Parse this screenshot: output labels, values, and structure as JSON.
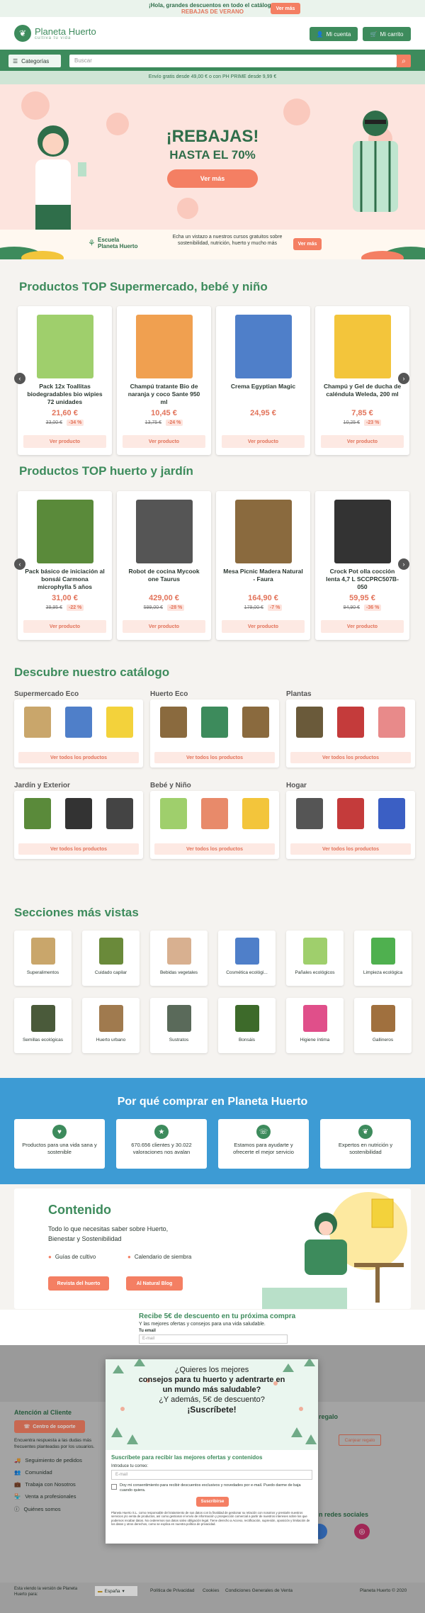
{
  "topbar": {
    "promo": "¡Hola, grandes descuentos en todo el catálogo!",
    "sale": "REBAJAS DE VERANO",
    "cta": "Ver más"
  },
  "header": {
    "brand": "Planeta Huerto",
    "tagline": "cultiva tu vida",
    "account": "Mi cuenta",
    "cart": "Mi carrito"
  },
  "nav": {
    "categories": "Categorías",
    "search_placeholder": "Buscar"
  },
  "shipping": "Envío gratis desde 49,00 € o con PH PRIME desde 9,99 €",
  "hero": {
    "title": "¡REBAJAS!",
    "subtitle": "HASTA EL 70%",
    "cta": "Ver más"
  },
  "school": {
    "name1": "Escuela",
    "name2": "Planeta Huerto",
    "text": "Echa un vistazo a nuestros cursos gratuitos sobre sostenibilidad, nutrición, huerto y mucho más",
    "cta": "Ver más"
  },
  "section1": {
    "title": "Productos TOP Supermercado, bebé y niño",
    "products": [
      {
        "name": "Pack 12x Toallitas biodegradables bio wipies 72 unidades",
        "price": "21,60 €",
        "old": "33,00 €",
        "disc": "-34 %",
        "color": "#9fcf6c"
      },
      {
        "name": "Champú tratante Bio de naranja y coco Sante 950 ml",
        "price": "10,45 €",
        "old": "13,75 €",
        "disc": "-24 %",
        "color": "#f0a050"
      },
      {
        "name": "Crema Egyptian Magic",
        "price": "24,95 €",
        "old": "",
        "disc": "",
        "color": "#4f7fc9"
      },
      {
        "name": "Champú y Gel de ducha de caléndula Weleda, 200 ml",
        "price": "7,85 €",
        "old": "10,25 €",
        "disc": "-23 %",
        "color": "#f3c53b"
      }
    ]
  },
  "section2": {
    "title": "Productos TOP huerto y jardín",
    "products": [
      {
        "name": "Pack básico de iniciación al bonsái Carmona microphylla 5 años",
        "price": "31,00 €",
        "old": "39,95 €",
        "disc": "-22 %",
        "color": "#5a8a3a"
      },
      {
        "name": "Robot de cocina Mycook one Taurus",
        "price": "429,00 €",
        "old": "599,00 €",
        "disc": "-28 %",
        "color": "#555555"
      },
      {
        "name": "Mesa Picnic Madera Natural - Faura",
        "price": "164,90 €",
        "old": "179,00 €",
        "disc": "-7 %",
        "color": "#8a6a3e"
      },
      {
        "name": "Crock Pot olla cocción lenta 4,7 L SCCPRC507B-050",
        "price": "59,95 €",
        "old": "94,90 €",
        "disc": "-36 %",
        "color": "#333333"
      }
    ]
  },
  "view_product": "Ver producto",
  "catalog": {
    "title": "Descubre nuestro catálogo",
    "view_all": "Ver todos los productos",
    "categories": [
      {
        "name": "Supermercado Eco",
        "colors": [
          "#c9a66b",
          "#4f7fc9",
          "#f3d23b"
        ]
      },
      {
        "name": "Huerto Eco",
        "colors": [
          "#8a6a3e",
          "#3d8b5c",
          "#8a6a3e"
        ]
      },
      {
        "name": "Plantas",
        "colors": [
          "#6a5a3a",
          "#c43b3b",
          "#e88a8a"
        ]
      },
      {
        "name": "Jardín y Exterior",
        "colors": [
          "#5a8a3a",
          "#333333",
          "#444444"
        ]
      },
      {
        "name": "Bebé y Niño",
        "colors": [
          "#9fcf6c",
          "#e88a6a",
          "#f3c53b"
        ]
      },
      {
        "name": "Hogar",
        "colors": [
          "#555555",
          "#c43b3b",
          "#3b5fc4"
        ]
      }
    ]
  },
  "sections": {
    "title": "Secciones más vistas",
    "items": [
      {
        "name": "Superalimentos",
        "color": "#c9a66b"
      },
      {
        "name": "Cuidado capilar",
        "color": "#6a8a3a"
      },
      {
        "name": "Bebidas vegetales",
        "color": "#d8b090"
      },
      {
        "name": "Cosmética ecológi...",
        "color": "#4f7fc9"
      },
      {
        "name": "Pañales ecológicos",
        "color": "#9fcf6c"
      },
      {
        "name": "Limpieza ecológica",
        "color": "#4fb04f"
      },
      {
        "name": "Semillas ecológicas",
        "color": "#4a5a3a"
      },
      {
        "name": "Huerto urbano",
        "color": "#a07a4e"
      },
      {
        "name": "Sustratos",
        "color": "#5a6a5a"
      },
      {
        "name": "Bonsáis",
        "color": "#3d6a2a"
      },
      {
        "name": "Higiene íntima",
        "color": "#e04f8a"
      },
      {
        "name": "Gallineros",
        "color": "#a0703e"
      }
    ]
  },
  "why": {
    "title": "Por qué comprar en Planeta Huerto",
    "items": [
      {
        "text": "Productos para una vida sana y sostenible"
      },
      {
        "text": "670.656 clientes y 30.022 valoraciones nos avalan"
      },
      {
        "text": "Estamos para ayudarte y ofrecerte el mejor servicio"
      },
      {
        "text": "Expertos en nutrición y sostenibilidad"
      }
    ]
  },
  "content": {
    "title": "Contenido",
    "text": "Todo lo que necesitas saber sobre Huerto, Bienestar y Sostenibilidad",
    "link1": "Guías de cultivo",
    "link2": "Calendario de siembra",
    "btn1": "Revista del huerto",
    "btn2": "Al Natural Blog"
  },
  "newsletter": {
    "title": "Recibe 5€ de descuento en tu próxima compra",
    "text": "Y las mejores ofertas y consejos para una vida saludable.",
    "label": "Tu email",
    "placeholder": "E-mail"
  },
  "footer": {
    "support_title": "Atención al Cliente",
    "support_btn": "Centro de soporte",
    "support_text": "Encuentra respuesta a las dudas más frecuentes planteadas por los usuarios.",
    "links": [
      "Seguimiento de pedidos",
      "Comunidad",
      "Trabaja con Nosotros",
      "Venta a profesionales",
      "Quiénes somos"
    ],
    "gift": "regalo",
    "gift_btn": "Canjear regalo",
    "social": "n redes sociales",
    "legal": "Esta viendo la versión de Planeta Huerto para:",
    "country": "España",
    "privacy": "Política de Privacidad",
    "cookies": "Cookies",
    "conditions": "Condiciones Generales de Venta",
    "copyright": "Planeta Huerto © 2020"
  },
  "modal": {
    "line1": "¿Quieres los mejores",
    "line2": "consejos para tu huerto y adentrarte en",
    "line3": "un mundo más saludable?",
    "line4": "¿Y además, 5€ de descuento?",
    "line5": "¡Suscríbete!",
    "form_title": "Suscríbete para recibir las mejores ofertas y contenidos",
    "email_label": "Introduce tu correo:",
    "email_placeholder": "E-mail",
    "consent": "Doy mi consentimiento para recibir descuentos exclusivos y novedades por e-mail. Puedo darme de baja cuando quiera.",
    "submit": "Suscribirse",
    "legal": "Planeta Huerto S.L. como responsable del tratamiento de sus datos con la finalidad de gestionar su relación con nosotros y prestarle nuestros servicios y/o venta de productos, así como gestionar el envío de información y prospección comercial a partir de nuestros intereses sobre los que podemos recabar datos. No cederemos sus datos salvo obligación legal. Tiene derecho a Acceso, rectificación, supresión, oposición y limitación de los datos y otros derechos, como se explica en nuestra política de privacidad."
  }
}
